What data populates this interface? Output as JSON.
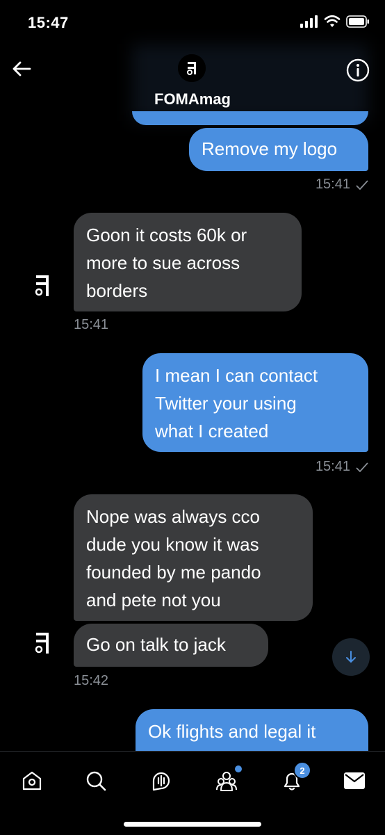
{
  "status": {
    "time": "15:47"
  },
  "header": {
    "name": "FOMAmag"
  },
  "messages": {
    "m1": {
      "text": "Remove my logo",
      "time": "15:41"
    },
    "m2": {
      "line1": "Goon it costs 60k or",
      "line2": "more to sue across",
      "line3": "borders",
      "time": "15:41"
    },
    "m3": {
      "line1": "I mean I can contact",
      "line2": "Twitter your using",
      "line3": "what I created",
      "time": "15:41"
    },
    "m4": {
      "line1": "Nope was always cco",
      "line2": "dude you know it was",
      "line3": "founded by me pando",
      "line4": "and pete not you"
    },
    "m5": {
      "text": "Go on talk to jack",
      "time": "15:42"
    },
    "m6": {
      "text": "Ok flights and legal it"
    }
  },
  "nav": {
    "notifications_badge": "2",
    "icons": [
      "home-icon",
      "search-icon",
      "spaces-icon",
      "communities-icon",
      "notifications-icon",
      "messages-icon"
    ]
  },
  "colors": {
    "outgoing": "#4a8fe0",
    "incoming": "#3a3b3d",
    "background": "#000000"
  }
}
